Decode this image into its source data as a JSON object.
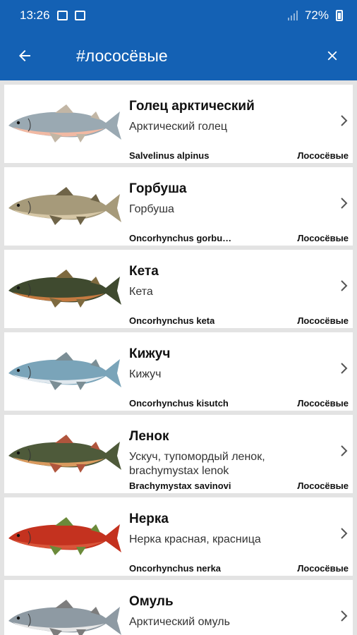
{
  "status": {
    "time": "13:26",
    "battery": "72%"
  },
  "toolbar": {
    "title": "#лососёвые",
    "back_icon": "arrow-left-icon",
    "close_icon": "close-icon"
  },
  "colors": {
    "primary": "#1461b4",
    "background": "#e3e3e3"
  },
  "fish": [
    {
      "name": "Голец арктический",
      "alt": "Арктический голец",
      "latin": "Salvelinus alpinus",
      "family": "Лососёвые",
      "body_color": "#9aa9b2",
      "belly_color": "#f1b9a3",
      "fin_color": "#c2b6a5"
    },
    {
      "name": "Горбуша",
      "alt": "Горбуша",
      "latin": "Oncorhynchus gorbu…",
      "family": "Лососёвые",
      "body_color": "#a69a7a",
      "belly_color": "#d6c7a6",
      "fin_color": "#6f6448"
    },
    {
      "name": "Кета",
      "alt": "Кета",
      "latin": "Oncorhynchus keta",
      "family": "Лососёвые",
      "body_color": "#3f4a2f",
      "belly_color": "#c47a40",
      "fin_color": "#7e6a3f"
    },
    {
      "name": "Кижуч",
      "alt": "Кижуч",
      "latin": "Oncorhynchus kisutch",
      "family": "Лососёвые",
      "body_color": "#7aa4b9",
      "belly_color": "#e0e8ee",
      "fin_color": "#7b8e95"
    },
    {
      "name": "Ленок",
      "alt": "Ускуч, тупомордый ленок, brachymystax lenok",
      "latin": "Brachymystax savinovi",
      "family": "Лососёвые",
      "body_color": "#4e5a3a",
      "belly_color": "#d99a5e",
      "fin_color": "#b0553d"
    },
    {
      "name": "Нерка",
      "alt": "Нерка красная, красница",
      "latin": "Oncorhynchus nerka",
      "family": "Лососёвые",
      "body_color": "#c4321f",
      "belly_color": "#d9553a",
      "fin_color": "#6b8a3a"
    },
    {
      "name": "Омуль",
      "alt": "Арктический омуль",
      "latin": "",
      "family": "",
      "body_color": "#8e9aa3",
      "belly_color": "#e6e6e6",
      "fin_color": "#7d7d7d"
    }
  ]
}
